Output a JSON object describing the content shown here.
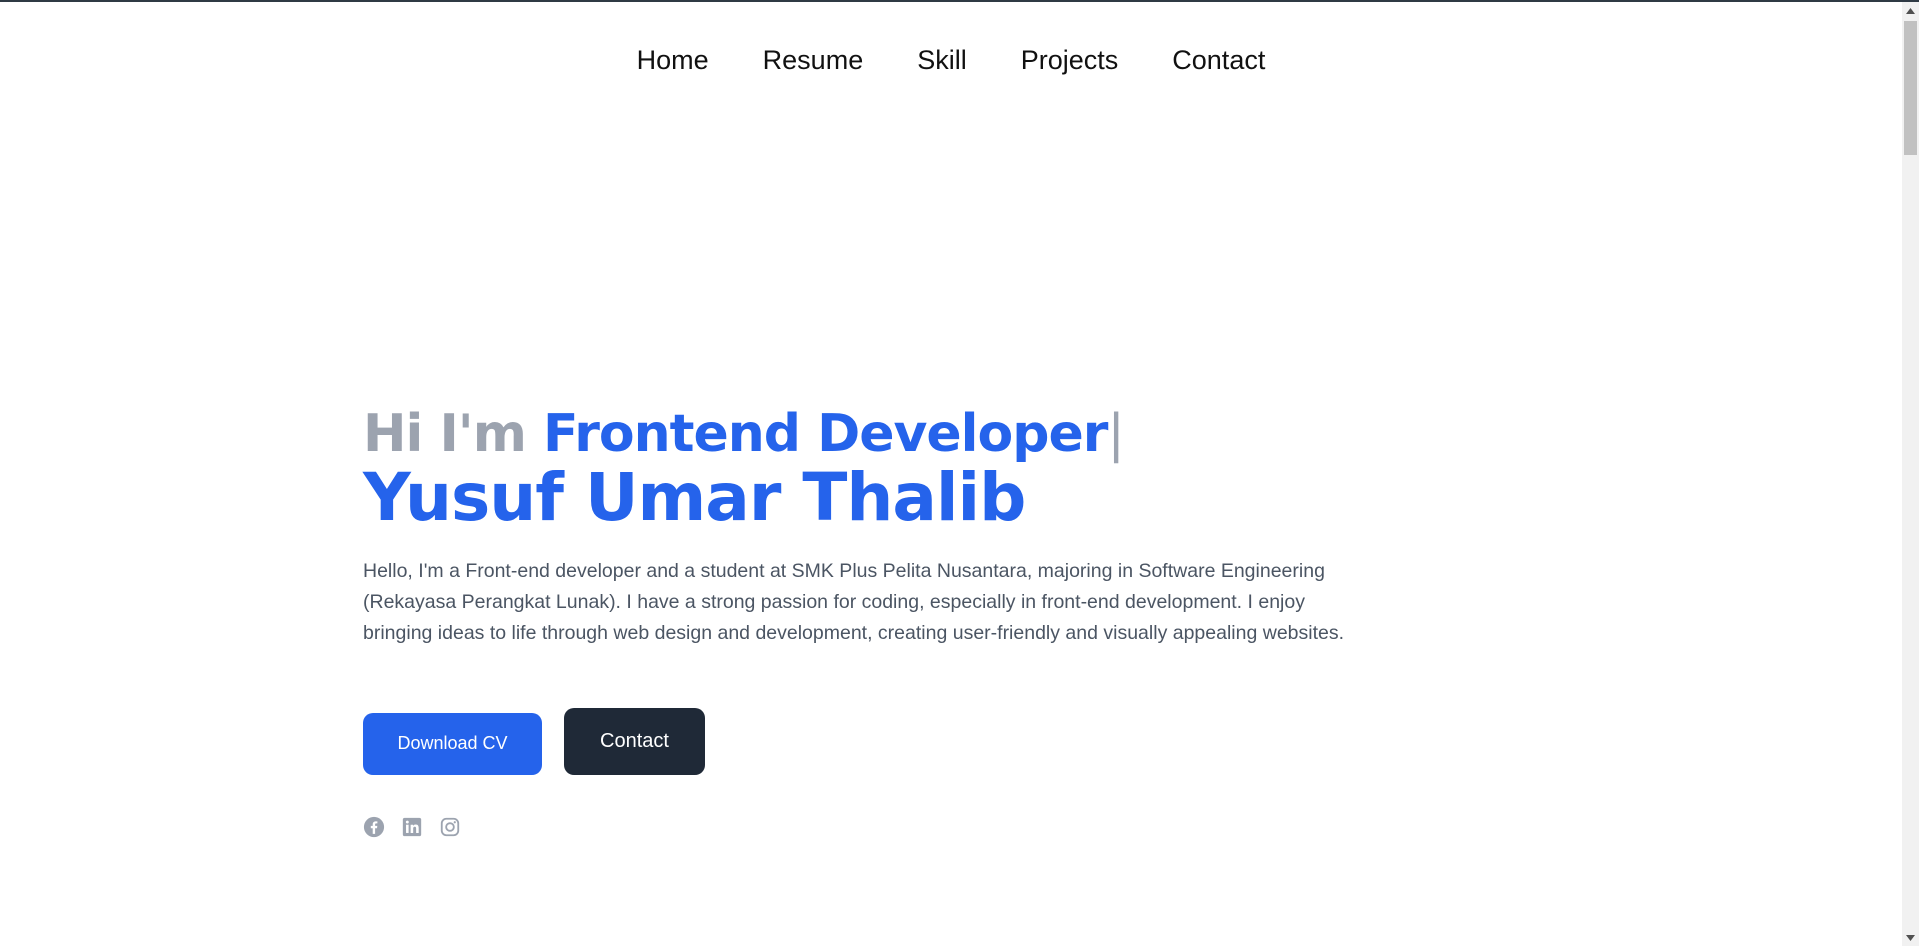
{
  "nav": {
    "items": [
      "Home",
      "Resume",
      "Skill",
      "Projects",
      "Contact"
    ]
  },
  "hero": {
    "greeting": "Hi I'm ",
    "role": "Frontend Developer",
    "cursor": "|",
    "name": "Yusuf Umar Thalib",
    "bio": "Hello, I'm a Front-end developer and a student at SMK Plus Pelita Nusantara, majoring in Software Engineering (Rekayasa Perangkat Lunak). I have a strong passion for coding, especially in front-end development. I enjoy bringing ideas to life through web design and development, creating user-friendly and visually appealing websites."
  },
  "buttons": {
    "download_cv": "Download CV",
    "contact": "Contact"
  },
  "socials": [
    "facebook-icon",
    "linkedin-icon",
    "instagram-icon"
  ],
  "colors": {
    "accent": "#2563eb",
    "muted": "#9ca3af",
    "dark_button": "#1f2937",
    "body_text": "#4b5563"
  }
}
